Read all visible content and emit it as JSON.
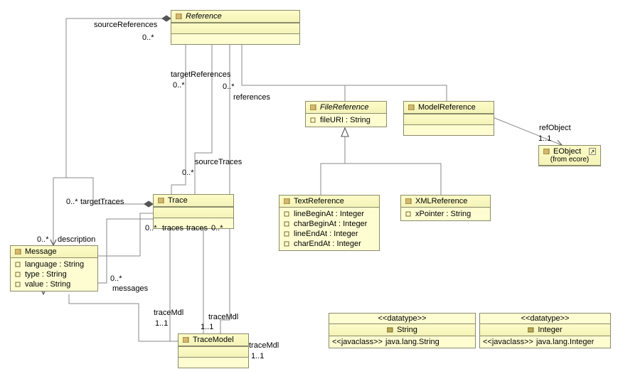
{
  "classes": {
    "reference": {
      "name": "Reference"
    },
    "filereference": {
      "name": "FileReference",
      "a1": "fileURI : String"
    },
    "modelreference": {
      "name": "ModelReference"
    },
    "eobject": {
      "name": "EObject",
      "from": "(from ecore)"
    },
    "trace": {
      "name": "Trace"
    },
    "textreference": {
      "name": "TextReference",
      "a1": "lineBeginAt : Integer",
      "a2": "charBeginAt : Integer",
      "a3": "lineEndAt : Integer",
      "a4": "charEndAt : Integer"
    },
    "xmlreference": {
      "name": "XMLReference",
      "a1": "xPointer : String"
    },
    "message": {
      "name": "Message",
      "a1": "language : String",
      "a2": "type : String",
      "a3": "value : String"
    },
    "tracemodel": {
      "name": "TraceModel"
    },
    "string": {
      "stereo": "<<datatype>>",
      "name": "String",
      "jstereo": "<<javaclass>>",
      "jname": "java.lang.String"
    },
    "integer": {
      "stereo": "<<datatype>>",
      "name": "Integer",
      "jstereo": "<<javaclass>>",
      "jname": "java.lang.Integer"
    }
  },
  "labels": {
    "sourceReferences": "sourceReferences",
    "m0s1": "0..*",
    "targetReferences": "targetReferences",
    "m0s2": "0..*",
    "references": "references",
    "m0s3": "0..*",
    "sourceTraces": "sourceTraces",
    "m0s4": "0..*",
    "targetTraces": "targetTraces",
    "m0s5": "0..*",
    "tracesA": "traces",
    "m0s6": "0..*",
    "tracesB": "traces",
    "m0s6b": "0..*",
    "description": "description",
    "m0s7": "0..*",
    "messages": "messages",
    "m0s8": "0..*",
    "traceMdlA": "traceMdl",
    "m11a": "1..1",
    "traceMdlB": "traceMdl",
    "m11b": "1..1",
    "traceMdlC": "traceMdl",
    "m11c": "1..1",
    "refObject": "refObject",
    "m11d": "1..1"
  }
}
